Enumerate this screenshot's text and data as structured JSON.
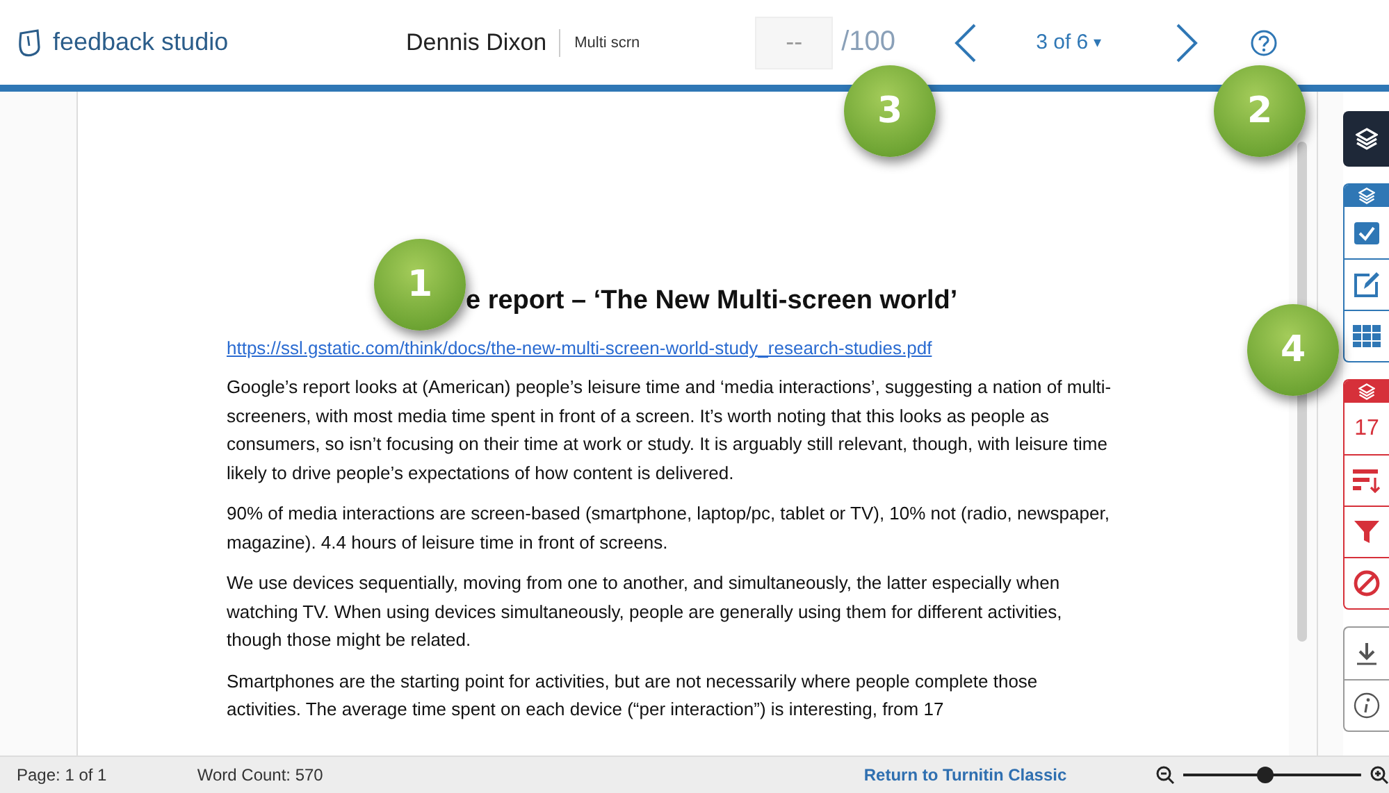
{
  "header": {
    "logo_text": "feedback studio",
    "student": "Dennis Dixon",
    "assignment": "Multi scrn",
    "grade": {
      "placeholder": "--",
      "out_of": "/100"
    },
    "pager": {
      "label": "3 of 6",
      "caret": "▾"
    }
  },
  "document": {
    "heading": "e report – ‘The New Multi-screen world’",
    "link": "https://ssl.gstatic.com/think/docs/the-new-multi-screen-world-study_research-studies.pdf",
    "paragraphs": [
      "Google’s report looks at (American) people’s leisure time and ‘media interactions’, suggesting a nation of multi-screeners, with most media time spent in front of a screen. It’s worth noting that this looks as people as consumers, so isn’t focusing on their time at work or study. It is arguably still relevant, though, with leisure time likely to drive people’s expectations of how content is delivered.",
      "90% of media interactions are screen-based (smartphone, laptop/pc, tablet or TV), 10% not (radio, newspaper, magazine). 4.4 hours of leisure time in front of screens.",
      "We use devices sequentially, moving from one to another, and simultaneously, the latter especially when watching TV. When using devices simultaneously, people are generally using them for different activities, though those might be related.",
      "Smartphones are the starting point for activities, but are not necessarily where people complete those activities. The average time spent on each device (“per interaction”) is interesting, from 17"
    ]
  },
  "toolbar": {
    "groups": [
      {
        "color": "#1e2838",
        "kind": "solid",
        "items": [
          {
            "kind": "layers"
          }
        ]
      },
      {
        "color": "#2f77b5",
        "kind": "headed",
        "items": [
          {
            "kind": "check"
          },
          {
            "kind": "edit"
          },
          {
            "kind": "grid"
          }
        ]
      },
      {
        "color": "#d6303a",
        "kind": "headed",
        "items": [
          {
            "kind": "count",
            "text": "17"
          },
          {
            "kind": "sort"
          },
          {
            "kind": "filter"
          },
          {
            "kind": "ban"
          }
        ]
      },
      {
        "color": "#9a9a9a",
        "kind": "plain",
        "items": [
          {
            "kind": "download"
          },
          {
            "kind": "info"
          }
        ]
      }
    ]
  },
  "status_bar": {
    "page": "Page: 1 of 1",
    "word_count": "Word Count: 570",
    "link": "Return to Turnitin Classic",
    "zoom": {
      "level": 0.46
    }
  },
  "callouts": [
    {
      "number": "1"
    },
    {
      "number": "3"
    },
    {
      "number": "2"
    },
    {
      "number": "4"
    }
  ]
}
